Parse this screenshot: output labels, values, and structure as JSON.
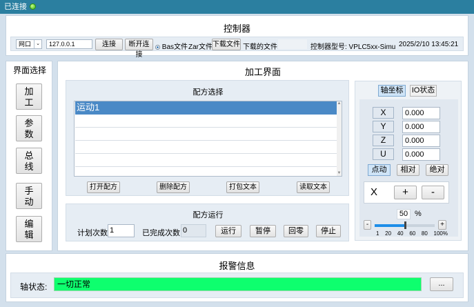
{
  "status": {
    "label": "已连接"
  },
  "controller": {
    "title": "控制器",
    "conn_type": "网口",
    "ip": "127.0.0.1",
    "connect_btn": "连接",
    "disconnect_btn": "断开连接",
    "bas_label": "Bas文件",
    "zar_label": "Zar文件",
    "download_btn": "下载文件",
    "downloaded_label": "下载的文件:",
    "downloaded_value": "",
    "model_label": "控制器型号: VPLC5xx-Simu",
    "datetime": "2025/2/10 13:45:21"
  },
  "nav": {
    "title": "界面选择",
    "items": [
      "加\n工",
      "参\n数",
      "总\n线",
      "手\n动",
      "编\n辑"
    ]
  },
  "main": {
    "title": "加工界面"
  },
  "recipe": {
    "title": "配方选择",
    "items": [
      "运动1"
    ],
    "btn_open": "打开配方",
    "btn_delete": "删除配方",
    "btn_pack": "打包文本",
    "btn_read": "读取文本"
  },
  "run": {
    "title": "配方运行",
    "plan_label": "计划次数",
    "plan_value": "1",
    "done_label": "已完成次数",
    "done_value": "0",
    "btn_run": "运行",
    "btn_pause": "暂停",
    "btn_home": "回零",
    "btn_stop": "停止"
  },
  "axis": {
    "tab_coord": "轴坐标",
    "tab_io": "IO状态",
    "axes": [
      {
        "name": "X",
        "value": "0.000"
      },
      {
        "name": "Y",
        "value": "0.000"
      },
      {
        "name": "Z",
        "value": "0.000"
      },
      {
        "name": "U",
        "value": "0.000"
      }
    ],
    "mode_inch": "点动",
    "mode_rel": "相对",
    "mode_abs": "绝对",
    "jog_axis": "X",
    "plus": "+",
    "minus": "-",
    "speed_value": "50",
    "speed_unit": "%",
    "speed_fraction": 0.5,
    "slider_minus": "-",
    "slider_plus": "+",
    "ticks": [
      "1",
      "20",
      "40",
      "60",
      "80",
      "100%"
    ]
  },
  "alarm": {
    "title": "报警信息",
    "axis_status_label": "轴状态:",
    "axis_status_value": "一切正常",
    "more_btn": "..."
  },
  "colors": {
    "accent": "#2b7fa0",
    "selected": "#4a89c6",
    "ok": "#0eff6e"
  }
}
